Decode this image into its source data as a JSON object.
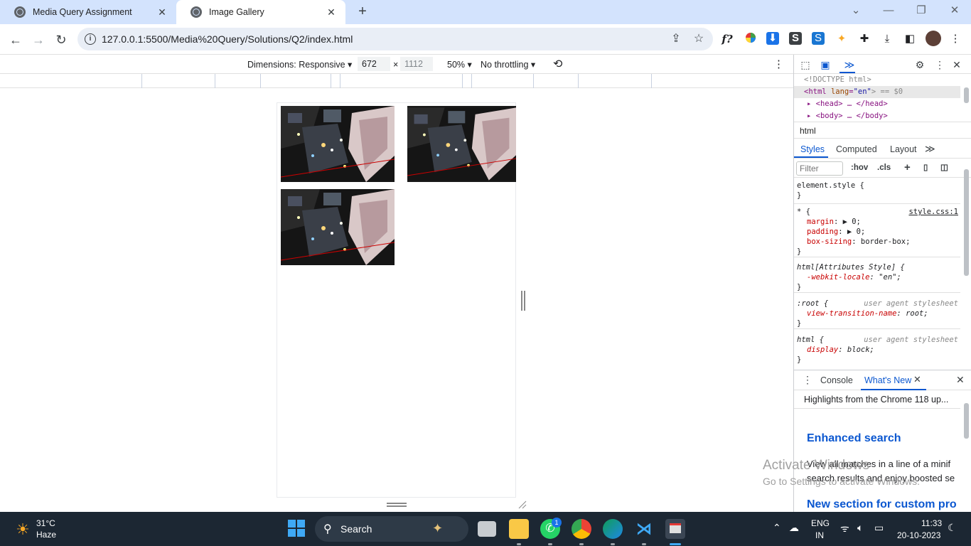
{
  "browser": {
    "tabs": [
      {
        "title": "Media Query Assignment",
        "active": false
      },
      {
        "title": "Image Gallery",
        "active": true
      }
    ],
    "url": "127.0.0.1:5500/Media%20Query/Solutions/Q2/index.html"
  },
  "device_toolbar": {
    "dimensions_label": "Dimensions: Responsive",
    "width": "672",
    "height": "1112",
    "zoom": "50%",
    "throttle": "No throttling"
  },
  "gallery": {
    "images": [
      {
        "alt": "city aerial night"
      },
      {
        "alt": "city aerial night"
      },
      {
        "alt": "city aerial night"
      }
    ]
  },
  "watermark": {
    "line1": "Activate Windows",
    "line2": "Go to Settings to activate Windows."
  },
  "devtools": {
    "elements": {
      "doctype": "<!DOCTYPE html>",
      "html_tag": "<html",
      "html_attr": "lang",
      "html_val": "\"en\"",
      "html_suffix": "> == $0",
      "head": "<head> … </head>",
      "body": "<body> … </body>"
    },
    "breadcrumb": "html",
    "tabs": [
      "Styles",
      "Computed",
      "Layout"
    ],
    "filter_placeholder": "Filter",
    "hov": ":hov",
    "cls": ".cls",
    "rules": {
      "element_style": "element.style {",
      "close": "}",
      "star_sel": "* {",
      "star_src": "style.css:1",
      "margin_prop": "margin",
      "margin_val": "▶ 0;",
      "padding_prop": "padding",
      "padding_val": "▶ 0;",
      "boxsizing_prop": "box-sizing",
      "boxsizing_val": "border-box;",
      "attr_sel": "html[Attributes Style] {",
      "locale_prop": "-webkit-locale",
      "locale_val": "\"en\";",
      "root_sel": ":root {",
      "ua": "user agent stylesheet",
      "vtn_prop": "view-transition-name",
      "vtn_val": "root;",
      "html_sel": "html {",
      "display_prop": "display",
      "display_val": "block;"
    },
    "drawer": {
      "console": "Console",
      "whatsnew": "What's New",
      "highlight": "Highlights from the Chrome 118 up...",
      "h1": "Enhanced search",
      "p1": "View all matches in a line of a minif",
      "p2": "search results and enjoy boosted se",
      "h2": "New section for custom pro"
    }
  },
  "taskbar": {
    "temp": "31°C",
    "weather": "Haze",
    "search": "Search",
    "lang1": "ENG",
    "lang2": "IN",
    "time": "11:33",
    "date": "20-10-2023",
    "whatsapp_badge": "1"
  }
}
